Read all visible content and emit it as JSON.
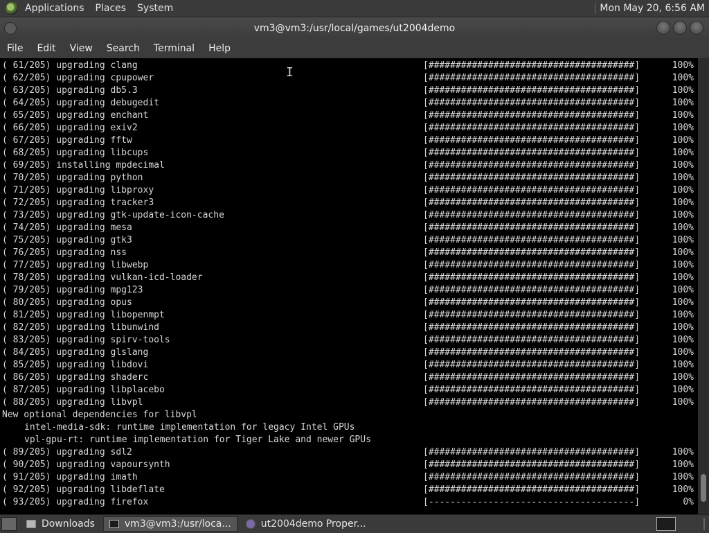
{
  "top_panel": {
    "menus": [
      "Applications",
      "Places",
      "System"
    ],
    "clock": "Mon May 20,  6:56 AM"
  },
  "window": {
    "title": "vm3@vm3:/usr/local/games/ut2004demo"
  },
  "menubar": [
    "File",
    "Edit",
    "View",
    "Search",
    "Terminal",
    "Help"
  ],
  "terminal": {
    "rows1": [
      {
        "left": "( 61/205) upgrading clang",
        "bar": "[######################################]",
        "pct": "100%"
      },
      {
        "left": "( 62/205) upgrading cpupower",
        "bar": "[######################################]",
        "pct": "100%"
      },
      {
        "left": "( 63/205) upgrading db5.3",
        "bar": "[######################################]",
        "pct": "100%"
      },
      {
        "left": "( 64/205) upgrading debugedit",
        "bar": "[######################################]",
        "pct": "100%"
      },
      {
        "left": "( 65/205) upgrading enchant",
        "bar": "[######################################]",
        "pct": "100%"
      },
      {
        "left": "( 66/205) upgrading exiv2",
        "bar": "[######################################]",
        "pct": "100%"
      },
      {
        "left": "( 67/205) upgrading fftw",
        "bar": "[######################################]",
        "pct": "100%"
      },
      {
        "left": "( 68/205) upgrading libcups",
        "bar": "[######################################]",
        "pct": "100%"
      },
      {
        "left": "( 69/205) installing mpdecimal",
        "bar": "[######################################]",
        "pct": "100%"
      },
      {
        "left": "( 70/205) upgrading python",
        "bar": "[######################################]",
        "pct": "100%"
      },
      {
        "left": "( 71/205) upgrading libproxy",
        "bar": "[######################################]",
        "pct": "100%"
      },
      {
        "left": "( 72/205) upgrading tracker3",
        "bar": "[######################################]",
        "pct": "100%"
      },
      {
        "left": "( 73/205) upgrading gtk-update-icon-cache",
        "bar": "[######################################]",
        "pct": "100%"
      },
      {
        "left": "( 74/205) upgrading mesa",
        "bar": "[######################################]",
        "pct": "100%"
      },
      {
        "left": "( 75/205) upgrading gtk3",
        "bar": "[######################################]",
        "pct": "100%"
      },
      {
        "left": "( 76/205) upgrading nss",
        "bar": "[######################################]",
        "pct": "100%"
      },
      {
        "left": "( 77/205) upgrading libwebp",
        "bar": "[######################################]",
        "pct": "100%"
      },
      {
        "left": "( 78/205) upgrading vulkan-icd-loader",
        "bar": "[######################################]",
        "pct": "100%"
      },
      {
        "left": "( 79/205) upgrading mpg123",
        "bar": "[######################################]",
        "pct": "100%"
      },
      {
        "left": "( 80/205) upgrading opus",
        "bar": "[######################################]",
        "pct": "100%"
      },
      {
        "left": "( 81/205) upgrading libopenmpt",
        "bar": "[######################################]",
        "pct": "100%"
      },
      {
        "left": "( 82/205) upgrading libunwind",
        "bar": "[######################################]",
        "pct": "100%"
      },
      {
        "left": "( 83/205) upgrading spirv-tools",
        "bar": "[######################################]",
        "pct": "100%"
      },
      {
        "left": "( 84/205) upgrading glslang",
        "bar": "[######################################]",
        "pct": "100%"
      },
      {
        "left": "( 85/205) upgrading libdovi",
        "bar": "[######################################]",
        "pct": "100%"
      },
      {
        "left": "( 86/205) upgrading shaderc",
        "bar": "[######################################]",
        "pct": "100%"
      },
      {
        "left": "( 87/205) upgrading libplacebo",
        "bar": "[######################################]",
        "pct": "100%"
      },
      {
        "left": "( 88/205) upgrading libvpl",
        "bar": "[######################################]",
        "pct": "100%"
      }
    ],
    "notes": {
      "heading": "New optional dependencies for libvpl",
      "dep1": "intel-media-sdk: runtime implementation for legacy Intel GPUs",
      "dep2": "vpl-gpu-rt: runtime implementation for Tiger Lake and newer GPUs"
    },
    "rows2": [
      {
        "left": "( 89/205) upgrading sdl2",
        "bar": "[######################################]",
        "pct": "100%"
      },
      {
        "left": "( 90/205) upgrading vapoursynth",
        "bar": "[######################################]",
        "pct": "100%"
      },
      {
        "left": "( 91/205) upgrading imath",
        "bar": "[######################################]",
        "pct": "100%"
      },
      {
        "left": "( 92/205) upgrading libdeflate",
        "bar": "[######################################]",
        "pct": "100%"
      },
      {
        "left": "( 93/205) upgrading firefox",
        "bar": "[--------------------------------------]",
        "pct": "0%"
      }
    ],
    "cursor_glyph": "I"
  },
  "taskbar": {
    "tasks": [
      "Downloads",
      "vm3@vm3:/usr/loca...",
      "ut2004demo Proper..."
    ]
  }
}
